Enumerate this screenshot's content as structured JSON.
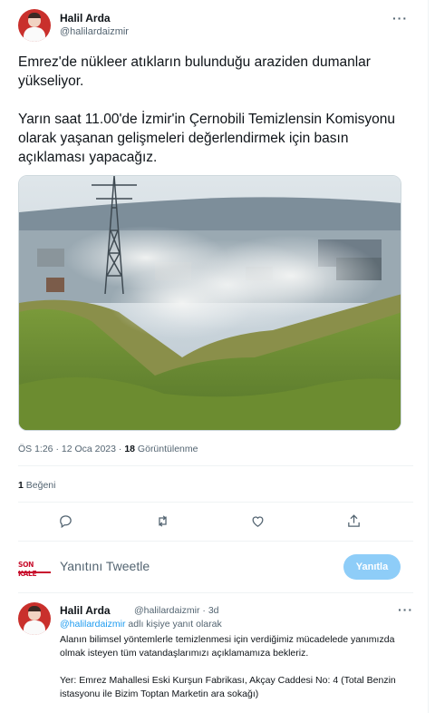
{
  "tweet": {
    "author_name": "Halil Arda",
    "author_handle": "@halilardaizmir",
    "more": "···",
    "paragraph_1": "Emrez'de nükleer atıkların bulunduğu araziden dumanlar yükseliyor.",
    "paragraph_2": "Yarın saat 11.00'de İzmir'in Çernobili Temizlensin Komisyonu olarak yaşanan gelişmeleri değerlendirmek için basın açıklaması yapacağız.",
    "time": "ÖS 1:26 · 12 Oca 2023 · ",
    "views_count": "18",
    "views_label": " Görüntülenme",
    "likes_count": "1",
    "likes_label": " Beğeni"
  },
  "actions": {
    "reply_icon": "reply-icon",
    "retweet_icon": "retweet-icon",
    "like_icon": "heart-icon",
    "share_icon": "share-icon"
  },
  "composer": {
    "logo_text": "SON KALE",
    "placeholder": "Yanıtını Tweetle",
    "button_label": "Yanıtla",
    "button_color": "#8ecdf8"
  },
  "reply": {
    "author_name": "Halil Arda",
    "author_handle": "@halilardaizmir · 3d",
    "more": "···",
    "reply_to_link": "@halilardaizmir",
    "reply_to_suffix": " adlı kişiye yanıt olarak",
    "paragraph_1": "Alanın bilimsel yöntemlerle temizlenmesi için verdiğimiz mücadelede yanımızda olmak isteyen tüm vatandaşlarımızı açıklamamıza bekleriz.",
    "paragraph_2": "Yer: Emrez Mahallesi Eski Kurşun Fabrikası, Akçay Caddesi No: 4 (Total Benzin istasyonu ile Bizim Toptan Marketin ara sokağı)"
  },
  "colors": {
    "accent": "#1d9bf0",
    "secondary_text": "#536471",
    "primary_text": "#0f1419"
  }
}
